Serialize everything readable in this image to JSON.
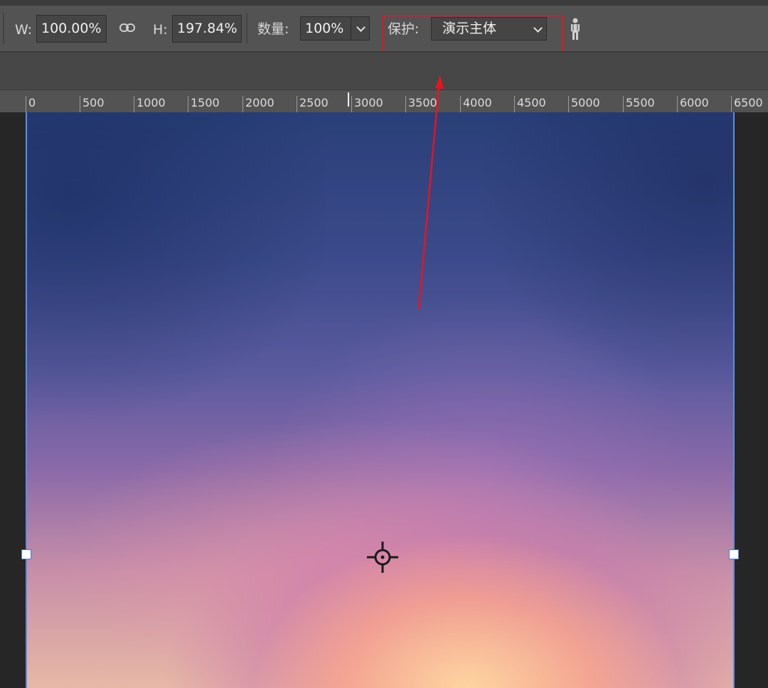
{
  "toolbar": {
    "width_label": "W:",
    "width_value": "100.00%",
    "height_label": "H:",
    "height_value": "197.84%",
    "amount_label": "数量:",
    "amount_value": "100%",
    "protect_label": "保护:",
    "protect_value": "演示主体",
    "link_icon": "chain-link-icon",
    "skin_tone_icon": "person-icon"
  },
  "ruler": {
    "ticks": [
      "0",
      "500",
      "1000",
      "1500",
      "2000",
      "2500",
      "3000",
      "3500",
      "4000",
      "4500",
      "5000",
      "5500",
      "6000",
      "6500"
    ]
  },
  "annotation": {
    "highlight_color": "#e8141e"
  },
  "colors": {
    "bounding_box": "#5b8ee6",
    "toolbar_bg": "#535353"
  }
}
